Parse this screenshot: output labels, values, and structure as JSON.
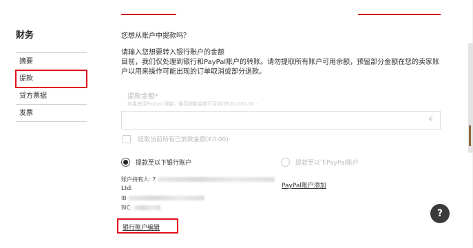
{
  "sidebar": {
    "title": "财务",
    "items": [
      {
        "label": "摘要"
      },
      {
        "label": "提款"
      },
      {
        "label": "贷方票据"
      },
      {
        "label": "发票"
      }
    ]
  },
  "main": {
    "question": "您想从账户中提款吗？",
    "intro_line1": "请输入您想要转入银行账户的金额",
    "intro_line2": "目前，我们仅处理到银行和PayPal账户的转账。请勿提取所有账户可用余额，预留部分金额在您的卖家账户以用来操作可能出现的订单取消或部分退款。",
    "amount_label": "提款金额*",
    "amount_hint": "如果使用Paypal 提款，最高提款金额不可超过€20,000.00 -",
    "amount_value": "",
    "currency": "€",
    "withdraw_all_label": "提取当前所有已放款金额(€0.00)",
    "radio_bank_label": "提款至以下银行账户",
    "radio_paypal_label": "提款至以下PayPal账户",
    "account_holder_prefix": "账户持有人: 7",
    "account_ltd": "Ltd.",
    "iban_prefix": "IB",
    "bic_prefix": "BIC:",
    "paypal_add_link": "PayPal账户添加",
    "bank_edit_link": "银行账户编辑"
  },
  "help": {
    "label": "?"
  },
  "colors": {
    "accent": "#e1101c",
    "help_bg": "#3a3a3a"
  }
}
